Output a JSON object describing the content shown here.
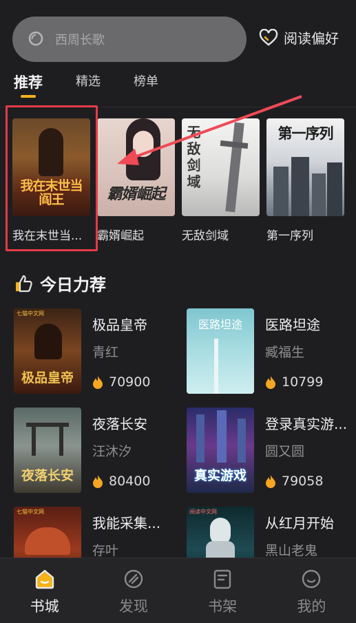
{
  "search": {
    "placeholder": "西周长歌"
  },
  "header": {
    "pref_label": "阅读偏好"
  },
  "tabs": [
    {
      "label": "推荐",
      "active": true
    },
    {
      "label": "精选",
      "active": false
    },
    {
      "label": "榜单",
      "active": false
    }
  ],
  "featured": [
    {
      "title": "我在末世当...",
      "cover_text": "我在末世当阎王"
    },
    {
      "title": "霸婿崛起",
      "cover_text": "霸婿崛起"
    },
    {
      "title": "无敌剑域",
      "cover_text": "无敌剑域"
    },
    {
      "title": "第一序列",
      "cover_text": "第一序列"
    }
  ],
  "section": {
    "title": "今日力荐"
  },
  "books": [
    {
      "title": "极品皇帝",
      "author": "青红",
      "heat": "70900",
      "cover_text": "极品皇帝",
      "brand": "七猫中文网"
    },
    {
      "title": "医路坦途",
      "author": "臧福生",
      "heat": "10799",
      "cover_text": "医路坦途",
      "brand": ""
    },
    {
      "title": "夜落长安",
      "author": "汪沐汐",
      "heat": "80400",
      "cover_text": "夜落长安",
      "brand": ""
    },
    {
      "title": "登录真实游...",
      "author": "圆又圆",
      "heat": "79058",
      "cover_text": "真实游戏",
      "brand": ""
    },
    {
      "title": "我能采集...",
      "author": "存叶",
      "heat": "",
      "cover_text": "",
      "brand": "七猫中文网"
    },
    {
      "title": "从红月开始",
      "author": "黑山老鬼",
      "heat": "",
      "cover_text": "",
      "brand": "阅读中文网"
    }
  ],
  "nav": [
    {
      "label": "书城",
      "icon": "bookstore-icon",
      "active": true
    },
    {
      "label": "发现",
      "icon": "discover-icon",
      "active": false
    },
    {
      "label": "书架",
      "icon": "bookshelf-icon",
      "active": false
    },
    {
      "label": "我的",
      "icon": "profile-icon",
      "active": false
    }
  ],
  "colors": {
    "accent": "#f5b21b",
    "highlight": "#e53b46",
    "background": "#1e1e21"
  }
}
